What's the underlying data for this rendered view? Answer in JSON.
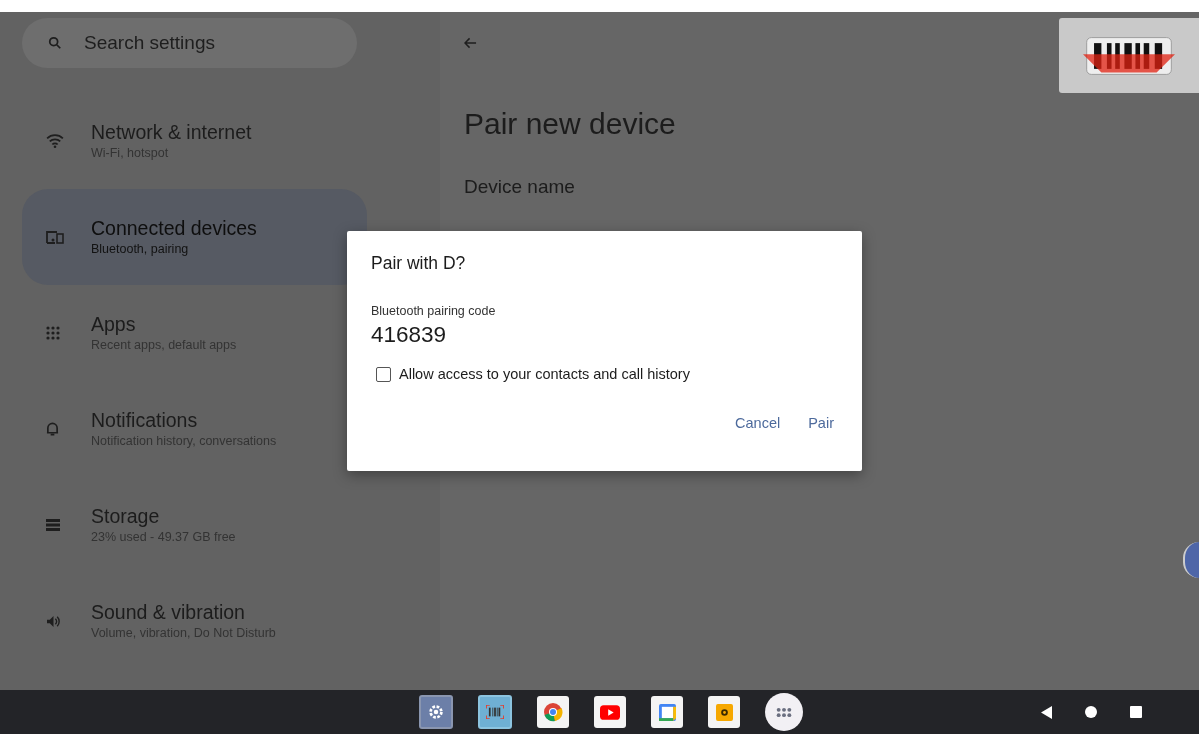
{
  "search": {
    "placeholder": "Search settings"
  },
  "sidebar": {
    "items": [
      {
        "kind": "wifi",
        "title": "Network & internet",
        "subtitle": "Wi-Fi, hotspot",
        "selected": false
      },
      {
        "kind": "devices",
        "title": "Connected devices",
        "subtitle": "Bluetooth, pairing",
        "selected": true
      },
      {
        "kind": "apps",
        "title": "Apps",
        "subtitle": "Recent apps, default apps",
        "selected": false
      },
      {
        "kind": "bell",
        "title": "Notifications",
        "subtitle": "Notification history, conversations",
        "selected": false
      },
      {
        "kind": "storage",
        "title": "Storage",
        "subtitle": "23% used - 49.37 GB free",
        "selected": false
      },
      {
        "kind": "sound",
        "title": "Sound & vibration",
        "subtitle": "Volume, vibration, Do Not Disturb",
        "selected": false
      }
    ]
  },
  "page": {
    "title": "Pair new device",
    "field_label": "Device name"
  },
  "dialog": {
    "title": "Pair with D?",
    "code_label": "Bluetooth pairing code",
    "code": "416839",
    "checkbox": {
      "label": "Allow access to your contacts and call history",
      "checked": false
    },
    "buttons": [
      "Cancel",
      "Pair"
    ]
  },
  "taskbar": {
    "apps": [
      {
        "kind": "settings",
        "running": true
      },
      {
        "kind": "barcode",
        "running": true
      },
      {
        "kind": "browser",
        "running": false
      },
      {
        "kind": "video",
        "running": false
      },
      {
        "kind": "calendar",
        "running": false
      },
      {
        "kind": "files",
        "running": false
      },
      {
        "kind": "launcher",
        "running": false
      }
    ]
  }
}
